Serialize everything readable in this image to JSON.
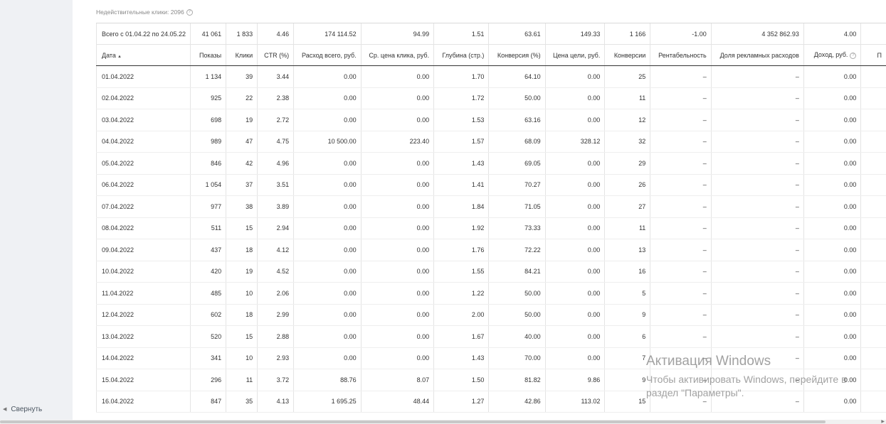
{
  "sidebar": {
    "collapse_label": "Свернуть"
  },
  "invalid_clicks": "Недействительные клики: 2096",
  "help_glyph": "?",
  "sort_arrow": "▲",
  "columns": [
    "Дата",
    "Показы",
    "Клики",
    "CTR (%)",
    "Расход всего, руб.",
    "Ср. цена клика, руб.",
    "Глубина (стр.)",
    "Конверсия (%)",
    "Цена цели, руб.",
    "Конверсии",
    "Рентабельность",
    "Доля рекламных расходов",
    "Доход, руб.",
    "П"
  ],
  "totals": [
    "Всего с 01.04.22 по 24.05.22",
    "41 061",
    "1 833",
    "4.46",
    "174 114.52",
    "94.99",
    "1.51",
    "63.61",
    "149.33",
    "1 166",
    "-1.00",
    "4 352 862.93",
    "4.00",
    ""
  ],
  "rows": [
    [
      "01.04.2022",
      "1 134",
      "39",
      "3.44",
      "0.00",
      "0.00",
      "1.70",
      "64.10",
      "0.00",
      "25",
      "–",
      "–",
      "0.00",
      ""
    ],
    [
      "02.04.2022",
      "925",
      "22",
      "2.38",
      "0.00",
      "0.00",
      "1.72",
      "50.00",
      "0.00",
      "11",
      "–",
      "–",
      "0.00",
      ""
    ],
    [
      "03.04.2022",
      "698",
      "19",
      "2.72",
      "0.00",
      "0.00",
      "1.53",
      "63.16",
      "0.00",
      "12",
      "–",
      "–",
      "0.00",
      ""
    ],
    [
      "04.04.2022",
      "989",
      "47",
      "4.75",
      "10 500.00",
      "223.40",
      "1.57",
      "68.09",
      "328.12",
      "32",
      "–",
      "–",
      "0.00",
      ""
    ],
    [
      "05.04.2022",
      "846",
      "42",
      "4.96",
      "0.00",
      "0.00",
      "1.43",
      "69.05",
      "0.00",
      "29",
      "–",
      "–",
      "0.00",
      ""
    ],
    [
      "06.04.2022",
      "1 054",
      "37",
      "3.51",
      "0.00",
      "0.00",
      "1.41",
      "70.27",
      "0.00",
      "26",
      "–",
      "–",
      "0.00",
      ""
    ],
    [
      "07.04.2022",
      "977",
      "38",
      "3.89",
      "0.00",
      "0.00",
      "1.84",
      "71.05",
      "0.00",
      "27",
      "–",
      "–",
      "0.00",
      ""
    ],
    [
      "08.04.2022",
      "511",
      "15",
      "2.94",
      "0.00",
      "0.00",
      "1.92",
      "73.33",
      "0.00",
      "11",
      "–",
      "–",
      "0.00",
      ""
    ],
    [
      "09.04.2022",
      "437",
      "18",
      "4.12",
      "0.00",
      "0.00",
      "1.76",
      "72.22",
      "0.00",
      "13",
      "–",
      "–",
      "0.00",
      ""
    ],
    [
      "10.04.2022",
      "420",
      "19",
      "4.52",
      "0.00",
      "0.00",
      "1.55",
      "84.21",
      "0.00",
      "16",
      "–",
      "–",
      "0.00",
      ""
    ],
    [
      "11.04.2022",
      "485",
      "10",
      "2.06",
      "0.00",
      "0.00",
      "1.22",
      "50.00",
      "0.00",
      "5",
      "–",
      "–",
      "0.00",
      ""
    ],
    [
      "12.04.2022",
      "602",
      "18",
      "2.99",
      "0.00",
      "0.00",
      "2.00",
      "50.00",
      "0.00",
      "9",
      "–",
      "–",
      "0.00",
      ""
    ],
    [
      "13.04.2022",
      "520",
      "15",
      "2.88",
      "0.00",
      "0.00",
      "1.67",
      "40.00",
      "0.00",
      "6",
      "–",
      "–",
      "0.00",
      ""
    ],
    [
      "14.04.2022",
      "341",
      "10",
      "2.93",
      "0.00",
      "0.00",
      "1.43",
      "70.00",
      "0.00",
      "7",
      "–",
      "–",
      "0.00",
      ""
    ],
    [
      "15.04.2022",
      "296",
      "11",
      "3.72",
      "88.76",
      "8.07",
      "1.50",
      "81.82",
      "9.86",
      "9",
      "–",
      "–",
      "0.00",
      ""
    ],
    [
      "16.04.2022",
      "847",
      "35",
      "4.13",
      "1 695.25",
      "48.44",
      "1.27",
      "42.86",
      "113.02",
      "15",
      "–",
      "–",
      "0.00",
      ""
    ]
  ],
  "watermark": {
    "title": "Активация Windows",
    "line1": "Чтобы активировать Windows, перейдите в",
    "line2": "раздел \"Параметры\"."
  }
}
